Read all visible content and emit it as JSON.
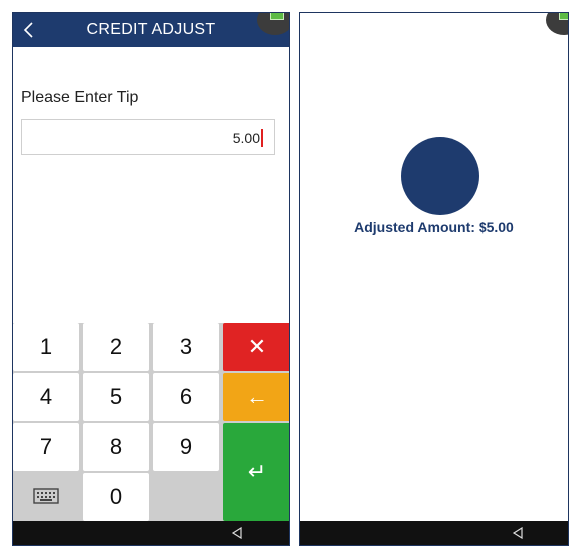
{
  "left_screen": {
    "header": {
      "title": "CREDIT ADJUST"
    },
    "tip_label": "Please Enter Tip",
    "tip_input": {
      "value": "5.00"
    },
    "keypad": {
      "keys": [
        "1",
        "2",
        "3",
        "4",
        "5",
        "6",
        "7",
        "8",
        "9",
        "0"
      ],
      "clear_symbol": "✕",
      "backspace_symbol": "←",
      "enter_symbol": "↵"
    }
  },
  "right_screen": {
    "adjusted_text": "Adjusted Amount: $5.00"
  },
  "colors": {
    "header_bg": "#1e3b6e",
    "clear_key": "#e02323",
    "backspace_key": "#f2a516",
    "enter_key": "#29a83b",
    "accent_text": "#1e3b6e"
  },
  "icons": [
    "back-chevron-icon",
    "keyboard-icon",
    "nav-back-triangle-icon",
    "status-indicator-icon"
  ]
}
